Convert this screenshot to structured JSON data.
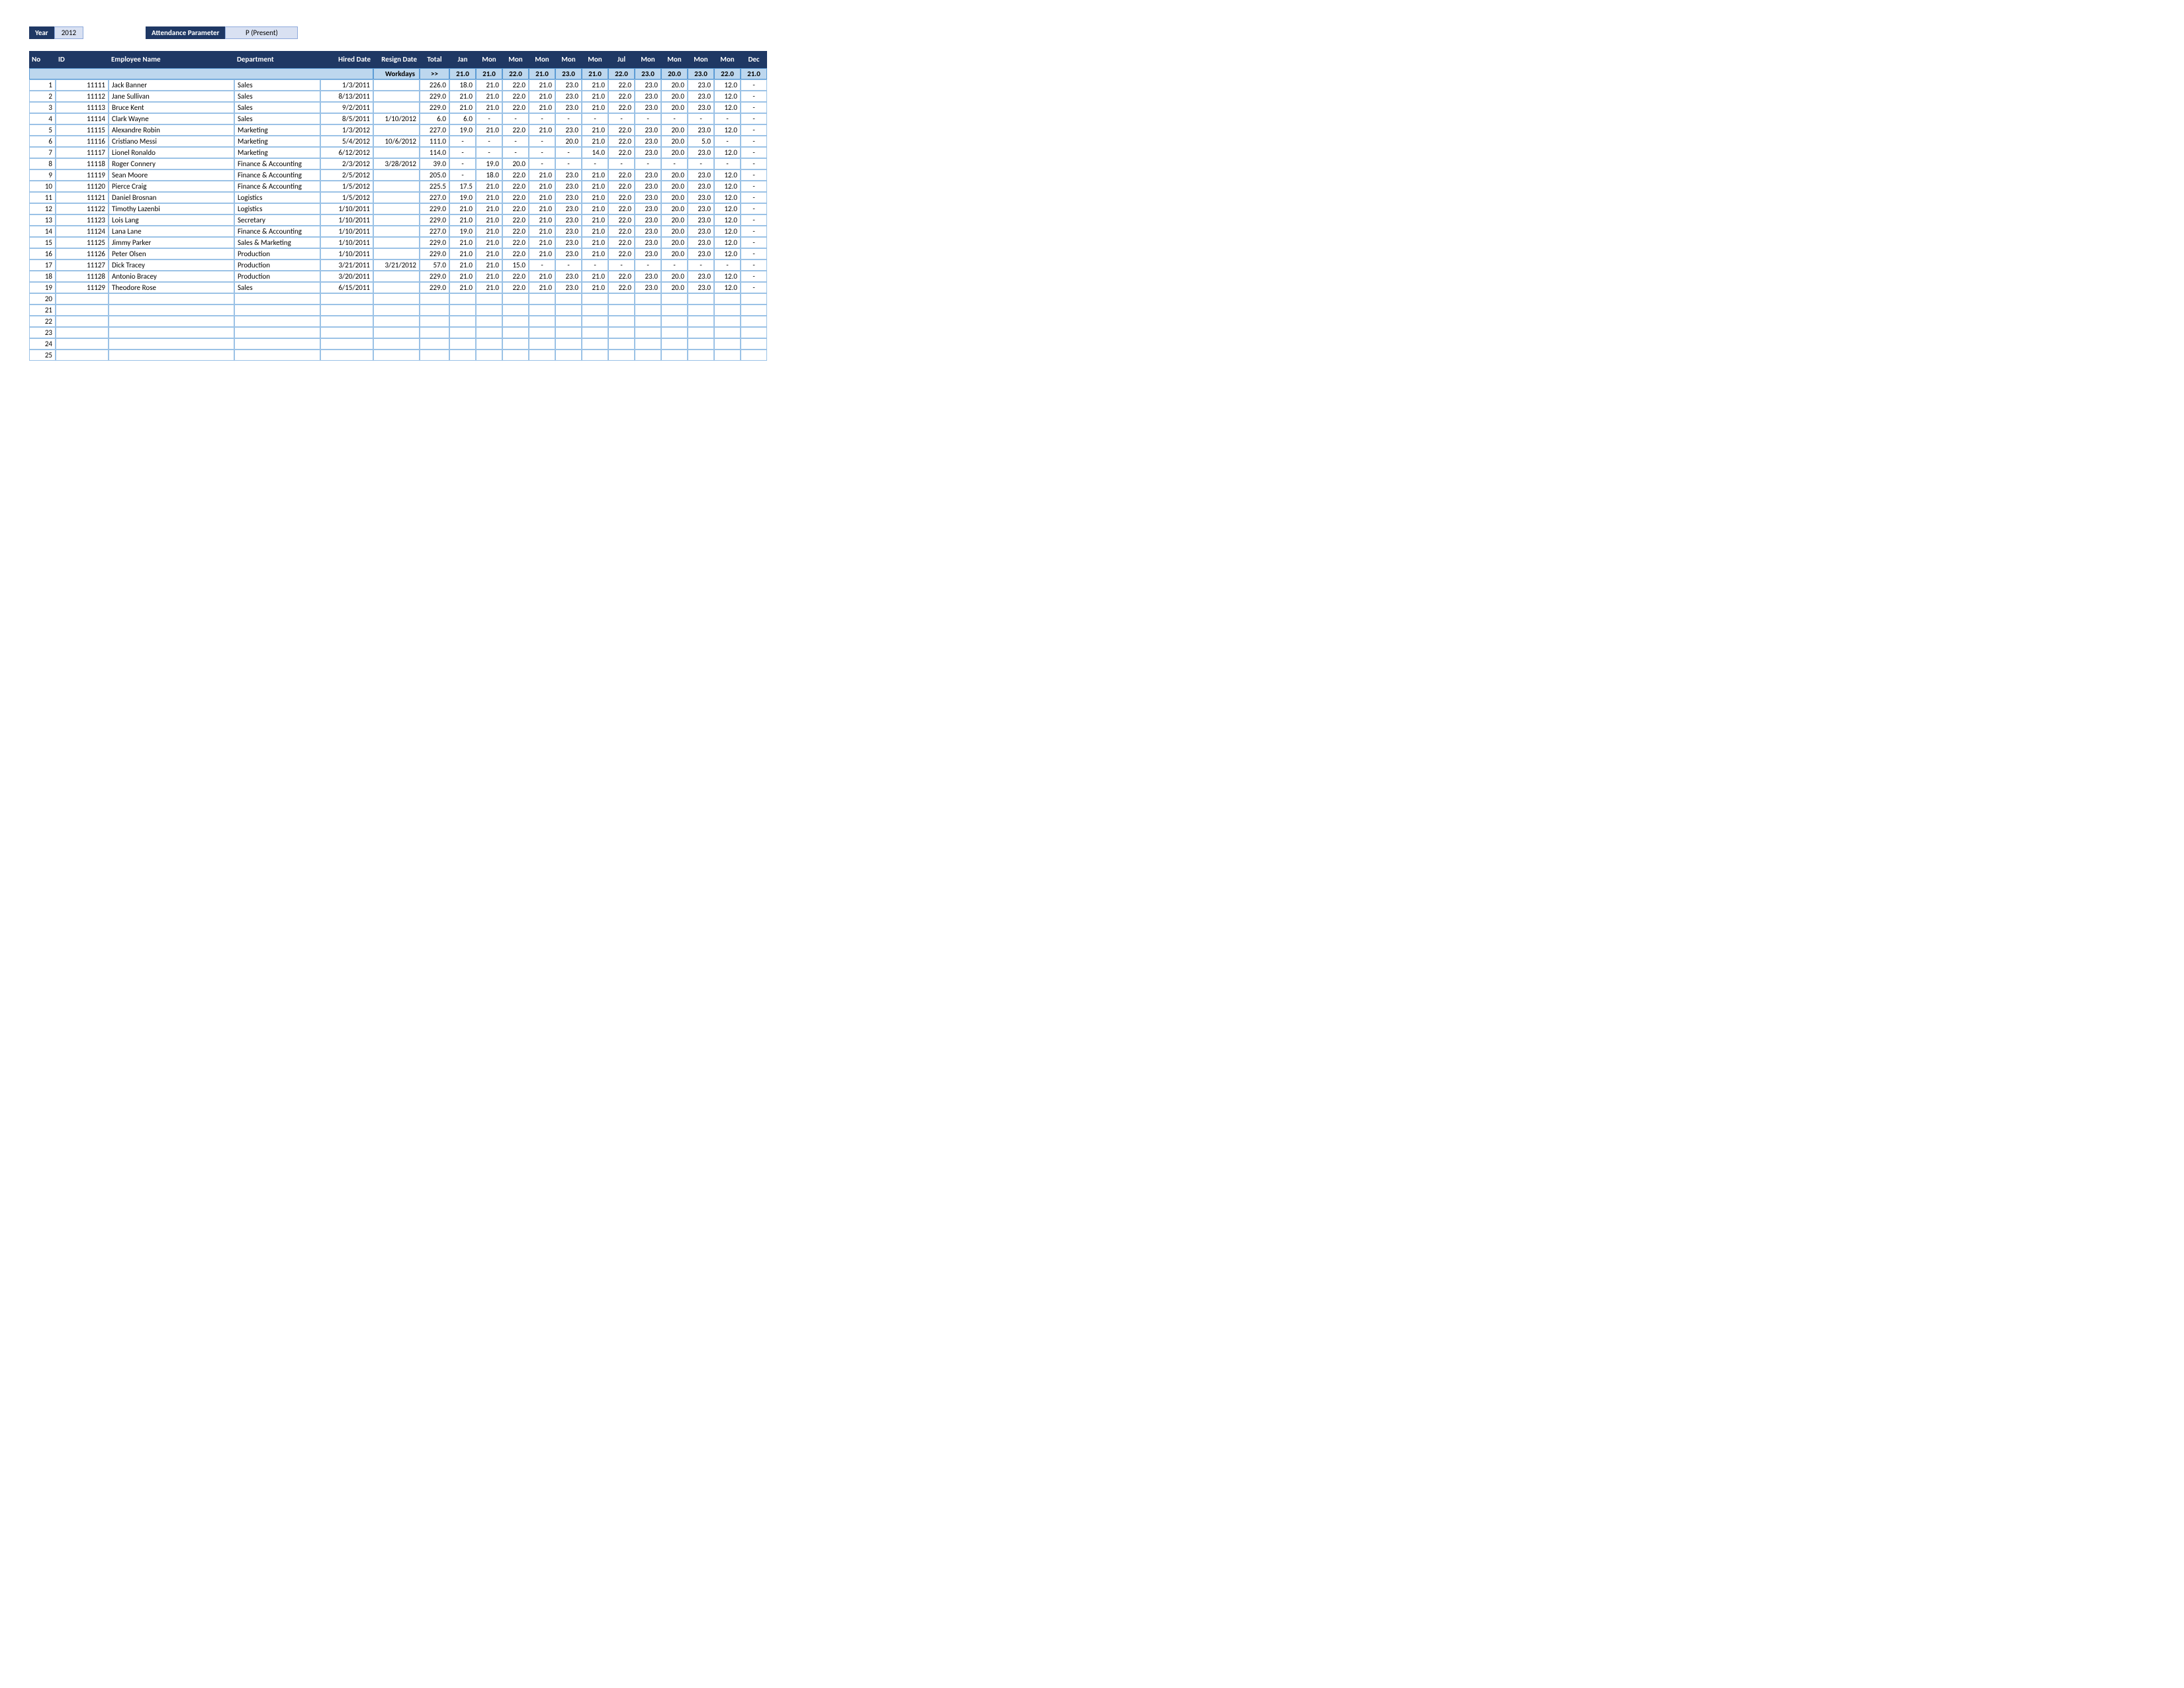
{
  "controls": {
    "year_label": "Year",
    "year_value": "2012",
    "param_label": "Attendance Parameter",
    "param_value": "P (Present)"
  },
  "columns": {
    "no": "No",
    "id": "ID",
    "name": "Employee Name",
    "dept": "Department",
    "hired": "Hired Date",
    "resign": "Resign Date",
    "total": "Total",
    "months": [
      "Jan",
      "Mon",
      "Mon",
      "Mon",
      "Mon",
      "Mon",
      "Jul",
      "Mon",
      "Mon",
      "Mon",
      "Mon",
      "Dec"
    ]
  },
  "workdays": {
    "label": "Workdays",
    "arrow": ">>",
    "values": [
      "21.0",
      "21.0",
      "22.0",
      "21.0",
      "23.0",
      "21.0",
      "22.0",
      "23.0",
      "20.0",
      "23.0",
      "22.0",
      "21.0"
    ]
  },
  "rows": [
    {
      "no": 1,
      "id": "11111",
      "name": "Jack Banner",
      "dept": "Sales",
      "hired": "1/3/2011",
      "resign": "",
      "total": "226.0",
      "m": [
        "18.0",
        "21.0",
        "22.0",
        "21.0",
        "23.0",
        "21.0",
        "22.0",
        "23.0",
        "20.0",
        "23.0",
        "12.0",
        "-"
      ]
    },
    {
      "no": 2,
      "id": "11112",
      "name": "Jane Sullivan",
      "dept": "Sales",
      "hired": "8/13/2011",
      "resign": "",
      "total": "229.0",
      "m": [
        "21.0",
        "21.0",
        "22.0",
        "21.0",
        "23.0",
        "21.0",
        "22.0",
        "23.0",
        "20.0",
        "23.0",
        "12.0",
        "-"
      ]
    },
    {
      "no": 3,
      "id": "11113",
      "name": "Bruce Kent",
      "dept": "Sales",
      "hired": "9/2/2011",
      "resign": "",
      "total": "229.0",
      "m": [
        "21.0",
        "21.0",
        "22.0",
        "21.0",
        "23.0",
        "21.0",
        "22.0",
        "23.0",
        "20.0",
        "23.0",
        "12.0",
        "-"
      ]
    },
    {
      "no": 4,
      "id": "11114",
      "name": "Clark Wayne",
      "dept": "Sales",
      "hired": "8/5/2011",
      "resign": "1/10/2012",
      "total": "6.0",
      "m": [
        "6.0",
        "-",
        "-",
        "-",
        "-",
        "-",
        "-",
        "-",
        "-",
        "-",
        "-",
        "-"
      ]
    },
    {
      "no": 5,
      "id": "11115",
      "name": "Alexandre Robin",
      "dept": "Marketing",
      "hired": "1/3/2012",
      "resign": "",
      "total": "227.0",
      "m": [
        "19.0",
        "21.0",
        "22.0",
        "21.0",
        "23.0",
        "21.0",
        "22.0",
        "23.0",
        "20.0",
        "23.0",
        "12.0",
        "-"
      ]
    },
    {
      "no": 6,
      "id": "11116",
      "name": "Cristiano Messi",
      "dept": "Marketing",
      "hired": "5/4/2012",
      "resign": "10/6/2012",
      "total": "111.0",
      "m": [
        "-",
        "-",
        "-",
        "-",
        "20.0",
        "21.0",
        "22.0",
        "23.0",
        "20.0",
        "5.0",
        "-",
        "-"
      ]
    },
    {
      "no": 7,
      "id": "11117",
      "name": "Lionel Ronaldo",
      "dept": "Marketing",
      "hired": "6/12/2012",
      "resign": "",
      "total": "114.0",
      "m": [
        "-",
        "-",
        "-",
        "-",
        "-",
        "14.0",
        "22.0",
        "23.0",
        "20.0",
        "23.0",
        "12.0",
        "-"
      ]
    },
    {
      "no": 8,
      "id": "11118",
      "name": "Roger Connery",
      "dept": "Finance & Accounting",
      "hired": "2/3/2012",
      "resign": "3/28/2012",
      "total": "39.0",
      "m": [
        "-",
        "19.0",
        "20.0",
        "-",
        "-",
        "-",
        "-",
        "-",
        "-",
        "-",
        "-",
        "-"
      ]
    },
    {
      "no": 9,
      "id": "11119",
      "name": "Sean Moore",
      "dept": "Finance & Accounting",
      "hired": "2/5/2012",
      "resign": "",
      "total": "205.0",
      "m": [
        "-",
        "18.0",
        "22.0",
        "21.0",
        "23.0",
        "21.0",
        "22.0",
        "23.0",
        "20.0",
        "23.0",
        "12.0",
        "-"
      ]
    },
    {
      "no": 10,
      "id": "11120",
      "name": "Pierce Craig",
      "dept": "Finance & Accounting",
      "hired": "1/5/2012",
      "resign": "",
      "total": "225.5",
      "m": [
        "17.5",
        "21.0",
        "22.0",
        "21.0",
        "23.0",
        "21.0",
        "22.0",
        "23.0",
        "20.0",
        "23.0",
        "12.0",
        "-"
      ]
    },
    {
      "no": 11,
      "id": "11121",
      "name": "Daniel Brosnan",
      "dept": "Logistics",
      "hired": "1/5/2012",
      "resign": "",
      "total": "227.0",
      "m": [
        "19.0",
        "21.0",
        "22.0",
        "21.0",
        "23.0",
        "21.0",
        "22.0",
        "23.0",
        "20.0",
        "23.0",
        "12.0",
        "-"
      ]
    },
    {
      "no": 12,
      "id": "11122",
      "name": "Timothy Lazenbi",
      "dept": "Logistics",
      "hired": "1/10/2011",
      "resign": "",
      "total": "229.0",
      "m": [
        "21.0",
        "21.0",
        "22.0",
        "21.0",
        "23.0",
        "21.0",
        "22.0",
        "23.0",
        "20.0",
        "23.0",
        "12.0",
        "-"
      ]
    },
    {
      "no": 13,
      "id": "11123",
      "name": "Lois Lang",
      "dept": "Secretary",
      "hired": "1/10/2011",
      "resign": "",
      "total": "229.0",
      "m": [
        "21.0",
        "21.0",
        "22.0",
        "21.0",
        "23.0",
        "21.0",
        "22.0",
        "23.0",
        "20.0",
        "23.0",
        "12.0",
        "-"
      ]
    },
    {
      "no": 14,
      "id": "11124",
      "name": "Lana Lane",
      "dept": "Finance & Accounting",
      "hired": "1/10/2011",
      "resign": "",
      "total": "227.0",
      "m": [
        "19.0",
        "21.0",
        "22.0",
        "21.0",
        "23.0",
        "21.0",
        "22.0",
        "23.0",
        "20.0",
        "23.0",
        "12.0",
        "-"
      ]
    },
    {
      "no": 15,
      "id": "11125",
      "name": "Jimmy Parker",
      "dept": "Sales & Marketing",
      "hired": "1/10/2011",
      "resign": "",
      "total": "229.0",
      "m": [
        "21.0",
        "21.0",
        "22.0",
        "21.0",
        "23.0",
        "21.0",
        "22.0",
        "23.0",
        "20.0",
        "23.0",
        "12.0",
        "-"
      ]
    },
    {
      "no": 16,
      "id": "11126",
      "name": "Peter Olsen",
      "dept": "Production",
      "hired": "1/10/2011",
      "resign": "",
      "total": "229.0",
      "m": [
        "21.0",
        "21.0",
        "22.0",
        "21.0",
        "23.0",
        "21.0",
        "22.0",
        "23.0",
        "20.0",
        "23.0",
        "12.0",
        "-"
      ]
    },
    {
      "no": 17,
      "id": "11127",
      "name": "Dick Tracey",
      "dept": "Production",
      "hired": "3/21/2011",
      "resign": "3/21/2012",
      "total": "57.0",
      "m": [
        "21.0",
        "21.0",
        "15.0",
        "-",
        "-",
        "-",
        "-",
        "-",
        "-",
        "-",
        "-",
        "-"
      ]
    },
    {
      "no": 18,
      "id": "11128",
      "name": "Antonio Bracey",
      "dept": "Production",
      "hired": "3/20/2011",
      "resign": "",
      "total": "229.0",
      "m": [
        "21.0",
        "21.0",
        "22.0",
        "21.0",
        "23.0",
        "21.0",
        "22.0",
        "23.0",
        "20.0",
        "23.0",
        "12.0",
        "-"
      ]
    },
    {
      "no": 19,
      "id": "11129",
      "name": "Theodore Rose",
      "dept": "Sales",
      "hired": "6/15/2011",
      "resign": "",
      "total": "229.0",
      "m": [
        "21.0",
        "21.0",
        "22.0",
        "21.0",
        "23.0",
        "21.0",
        "22.0",
        "23.0",
        "20.0",
        "23.0",
        "12.0",
        "-"
      ]
    }
  ],
  "empty_rows": [
    20,
    21,
    22,
    23,
    24,
    25
  ]
}
